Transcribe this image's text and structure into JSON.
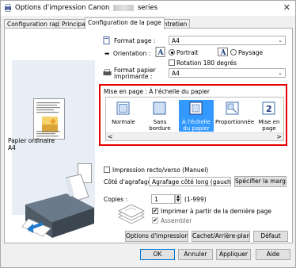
{
  "window": {
    "title_prefix": "Options d'impression Canon",
    "title_suffix": "series",
    "close_glyph": "✕"
  },
  "tabs": [
    {
      "label": "Configuration rapide"
    },
    {
      "label": "Principal"
    },
    {
      "label": "Configuration de la page"
    },
    {
      "label": "Entretien"
    }
  ],
  "left": {
    "paper_type": "Papier ordinaire",
    "paper_size": "A4"
  },
  "page": {
    "format_label": "Format page :",
    "format_value": "A4",
    "orientation_label": "Orientation :",
    "portrait_label": "Portrait",
    "paysage_label": "Paysage",
    "rotation_label": "Rotation 180 degrés",
    "printer_paper_label_1": "Format papier",
    "printer_paper_label_2": "imprimante :",
    "printer_paper_value": "A4"
  },
  "layout": {
    "title": "Mise en page :  À l'échelle du papier",
    "options": [
      {
        "label": "Normale"
      },
      {
        "label": "Sans bordure"
      },
      {
        "label": "À l'échelle du papier"
      },
      {
        "label": "Proportionnée"
      },
      {
        "label": "Mise en page"
      }
    ],
    "scroll_left": "<",
    "scroll_right": ">"
  },
  "duplex": {
    "label": "Impression recto/verso (Manuel)",
    "stapling_label": "Côté d'agrafage :",
    "stapling_value": "Agrafage côté long (gauche)",
    "margin_button": "Spécifier la marge..."
  },
  "copies": {
    "label": "Copies :",
    "value": "1",
    "range": "(1-999)",
    "last_page_label": "Imprimer à partir de la dernière page",
    "assemble_label": "Assembler"
  },
  "buttons": {
    "print_options": "Options d'impression...",
    "stamp_bg": "Cachet/Arrière-plan...",
    "default": "Défaut",
    "ok": "OK",
    "cancel": "Annuler",
    "apply": "Appliquer",
    "help": "Aide"
  },
  "colors": {
    "highlight": "#e60000",
    "selected": "#3399ff"
  }
}
